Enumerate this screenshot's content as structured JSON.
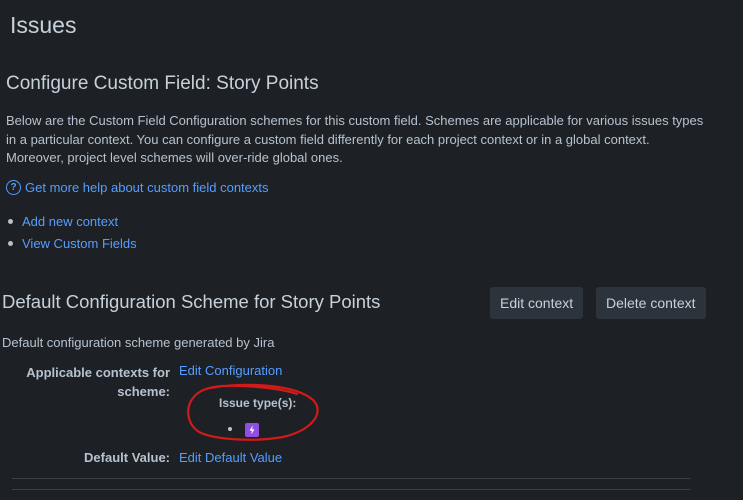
{
  "page": {
    "title": "Issues"
  },
  "configure": {
    "title": "Configure Custom Field: Story Points",
    "description": "Below are the Custom Field Configuration schemes for this custom field. Schemes are applicable for various issues types in a particular context. You can configure a custom field differently for each project context or in a global context. Moreover, project level schemes will over-ride global ones.",
    "help_link": "Get more help about custom field contexts",
    "links": [
      "Add new context",
      "View Custom Fields"
    ]
  },
  "scheme": {
    "title": "Default Configuration Scheme for Story Points",
    "edit_button": "Edit context",
    "delete_button": "Delete context",
    "description": "Default configuration scheme generated by Jira",
    "applicable_label": "Applicable contexts for scheme:",
    "edit_configuration": "Edit Configuration",
    "issue_types_label": "Issue type(s):",
    "default_value_label": "Default Value:",
    "edit_default_value": "Edit Default Value"
  },
  "colors": {
    "background": "#1d2125",
    "link": "#579dff",
    "annotation": "#d11a1a",
    "issue_icon": "#904ee2"
  },
  "icons": {
    "help": "question-circle-icon",
    "issue_type": "lightning-icon"
  }
}
